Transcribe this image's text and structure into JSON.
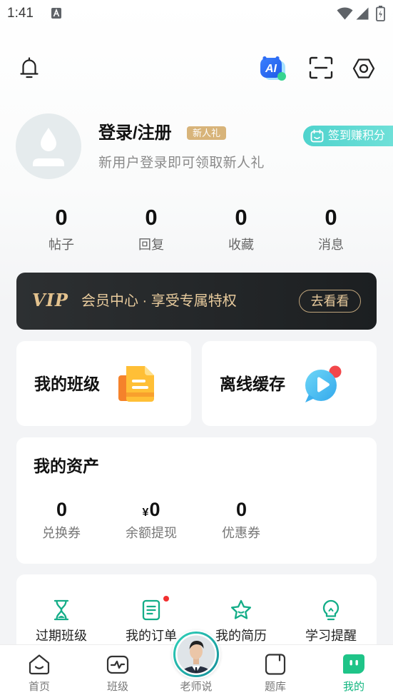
{
  "status_bar": {
    "time": "1:41",
    "icons": [
      "notification-a-icon",
      "wifi-icon",
      "signal-icon",
      "battery-charging-icon"
    ]
  },
  "header": {
    "ai_label": "AI",
    "icons": [
      "bell-icon",
      "ai-assistant-icon",
      "scan-icon",
      "settings-icon"
    ]
  },
  "profile": {
    "login_label": "登录/注册",
    "badge": "新人礼",
    "subtitle": "新用户登录即可领取新人礼",
    "checkin_label": "签到赚积分"
  },
  "stats": [
    {
      "value": "0",
      "label": "帖子"
    },
    {
      "value": "0",
      "label": "回复"
    },
    {
      "value": "0",
      "label": "收藏"
    },
    {
      "value": "0",
      "label": "消息"
    }
  ],
  "vip": {
    "logo": "VIP",
    "text": "会员中心 · 享受专属特权",
    "button": "去看看"
  },
  "shortcuts": [
    {
      "label": "我的班级",
      "icon": "class-document-icon"
    },
    {
      "label": "离线缓存",
      "icon": "offline-video-icon"
    }
  ],
  "assets": {
    "title": "我的资产",
    "items": [
      {
        "currency": "",
        "value": "0",
        "label": "兑换券"
      },
      {
        "currency": "¥",
        "value": "0",
        "label": "余额提现"
      },
      {
        "currency": "",
        "value": "0",
        "label": "优惠券"
      }
    ]
  },
  "services": [
    {
      "label": "过期班级",
      "icon": "hourglass-icon"
    },
    {
      "label": "我的订单",
      "icon": "order-icon",
      "badge_dot": true
    },
    {
      "label": "我的简历",
      "icon": "star-icon"
    },
    {
      "label": "学习提醒",
      "icon": "lightbulb-icon"
    }
  ],
  "bottom_nav": {
    "items": [
      {
        "label": "首页",
        "icon": "home-icon"
      },
      {
        "label": "班级",
        "icon": "pulse-icon"
      },
      {
        "label": "老师说",
        "icon": "teacher-avatar"
      },
      {
        "label": "题库",
        "icon": "question-bank-icon"
      },
      {
        "label": "我的",
        "icon": "me-chat-icon",
        "active": true
      }
    ]
  },
  "colors": {
    "accent": "#10b57f",
    "badge": "#d8b47a",
    "vip_gold": "#e8cb9d",
    "checkin": "#4fd3cd",
    "dot": "#f23030"
  }
}
